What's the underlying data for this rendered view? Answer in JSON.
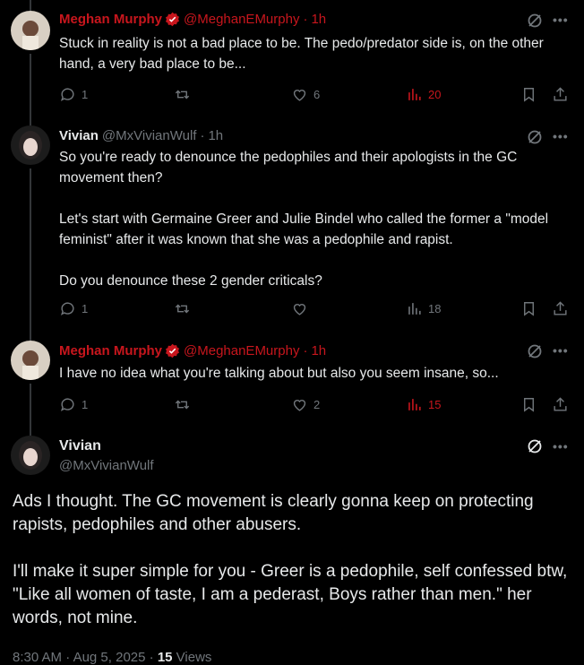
{
  "tweets": [
    {
      "name": "Meghan Murphy",
      "handle": "@MeghanEMurphy",
      "dot": "·",
      "time": "1h",
      "text": [
        "Stuck in reality is not a bad place to be. The pedo/predator side is, on the other hand, a very bad place to be..."
      ],
      "replies": "1",
      "reposts": "",
      "likes": "6",
      "views": "20"
    },
    {
      "name": "Vivian",
      "handle": "@MxVivianWulf",
      "dot": "·",
      "time": "1h",
      "text": [
        "So you're ready to denounce the pedophiles and their apologists in the GC movement then?",
        "Let's start with Germaine Greer and Julie Bindel who called the former a \"model feminist\" after it was known that she was a pedophile and rapist.",
        "Do you denounce these 2 gender criticals?"
      ],
      "replies": "1",
      "reposts": "",
      "likes": "",
      "views": "18"
    },
    {
      "name": "Meghan Murphy",
      "handle": "@MeghanEMurphy",
      "dot": "·",
      "time": "1h",
      "text": [
        "I have no idea what you're talking about but also you seem insane, so..."
      ],
      "replies": "1",
      "reposts": "",
      "likes": "2",
      "views": "15"
    }
  ],
  "main": {
    "name": "Vivian",
    "handle": "@MxVivianWulf",
    "text": [
      "Ads I thought. The GC movement is clearly gonna keep on protecting rapists, pedophiles and other abusers.",
      "I'll make it super simple for you - Greer is a pedophile, self confessed btw, \"Like all women of taste, I am a pederast, Boys rather than men.\" her words, not mine."
    ],
    "time": "8:30 AM",
    "sep1": "·",
    "date": "Aug 5, 2025",
    "sep2": "·",
    "views_count": "15",
    "views_label": "Views"
  },
  "icons": [
    "grok-icon",
    "more-icon",
    "reply-icon",
    "repost-icon",
    "like-icon",
    "views-icon",
    "bookmark-icon",
    "share-icon",
    "verified-badge-icon"
  ],
  "colors": {
    "background": "#000000",
    "accent_red": "#c8161d",
    "muted": "#71767b",
    "text": "#e7e9ea"
  }
}
